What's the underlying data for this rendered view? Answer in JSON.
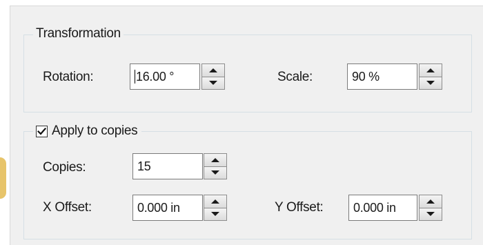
{
  "transformation": {
    "title": "Transformation",
    "rotation": {
      "label": "Rotation:",
      "value": "16.00 °"
    },
    "scale": {
      "label": "Scale:",
      "value": "90 %"
    }
  },
  "copies_group": {
    "title": "Apply to copies",
    "apply_checked": true,
    "copies": {
      "label": "Copies:",
      "value": "15"
    },
    "x_offset": {
      "label": "X Offset:",
      "value": "0.000 in"
    },
    "y_offset": {
      "label": "Y Offset:",
      "value": "0.000 in"
    }
  },
  "icons": {
    "spin_up": "triangle-up-icon",
    "spin_down": "triangle-down-icon",
    "check": "checkmark-icon"
  },
  "colors": {
    "panel_background": "#f0f0f0",
    "group_border": "#d5dfe5",
    "field_border": "#7a7a7a",
    "side_accent": "#e7c46a"
  }
}
